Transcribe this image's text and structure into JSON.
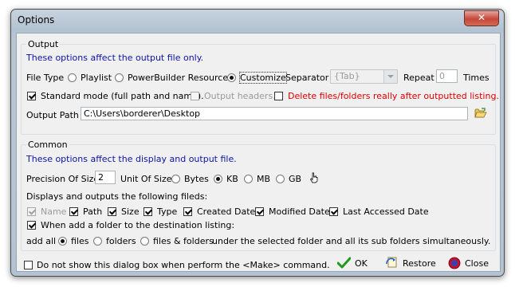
{
  "window": {
    "title": "Options",
    "close_glyph": "✕"
  },
  "output": {
    "group_title": "Output",
    "description": "These options affect the output file only.",
    "file_type_label": "File Type",
    "file_types": [
      {
        "label": "Playlist",
        "checked": false
      },
      {
        "label": "PowerBuilder Resources",
        "checked": false
      },
      {
        "label": "Customize",
        "checked": true
      }
    ],
    "separator_label": "Separator",
    "separator_value": "{Tab}",
    "repeat_label": "Repeat",
    "repeat_value": "0",
    "times_label": "Times",
    "standard_mode_label": "Standard mode (full path and name).",
    "output_headers_label": "Output headers.",
    "delete_label": "Delete files/folders really after outputted listing.",
    "output_path_label": "Output Path",
    "output_path_value": "C:\\Users\\borderer\\Desktop",
    "folder_icon": "open-folder-icon"
  },
  "common": {
    "group_title": "Common",
    "description": "These options affect the display and output file.",
    "precision_label": "Precision Of Size",
    "precision_value": "2",
    "unit_label": "Unit Of Size",
    "units": [
      {
        "label": "Bytes",
        "checked": false
      },
      {
        "label": "KB",
        "checked": true
      },
      {
        "label": "MB",
        "checked": false
      },
      {
        "label": "GB",
        "checked": false
      }
    ],
    "unit_icon": "hand-pointer-icon",
    "fields_caption": "Displays and outputs the following fileds:",
    "fields": [
      {
        "label": "Name",
        "checked": true,
        "disabled": true
      },
      {
        "label": "Path",
        "checked": true,
        "disabled": false
      },
      {
        "label": "Size",
        "checked": true,
        "disabled": false
      },
      {
        "label": "Type",
        "checked": true,
        "disabled": false
      },
      {
        "label": "Created Date",
        "checked": true,
        "disabled": false
      },
      {
        "label": "Modified Date",
        "checked": true,
        "disabled": false
      },
      {
        "label": "Last Accessed Date",
        "checked": true,
        "disabled": false
      }
    ],
    "add_folder_label": "When add a folder to the destination listing:",
    "add_all_label": "add all",
    "add_options": [
      {
        "label": "files",
        "checked": true
      },
      {
        "label": "folders",
        "checked": false
      },
      {
        "label": "files & folders",
        "checked": false
      }
    ],
    "under_label": "under the selected folder and all its sub folders simultaneously."
  },
  "footer": {
    "dont_show_label": "Do not show this dialog box when perform the <Make> command.",
    "ok_label": "OK",
    "restore_label": "Restore",
    "close_label": "Close"
  },
  "colors": {
    "accent_text": "#0d12a8",
    "warning_text": "#e00000",
    "ok_check": "#1f9a1f",
    "close_red": "#c8102e"
  }
}
